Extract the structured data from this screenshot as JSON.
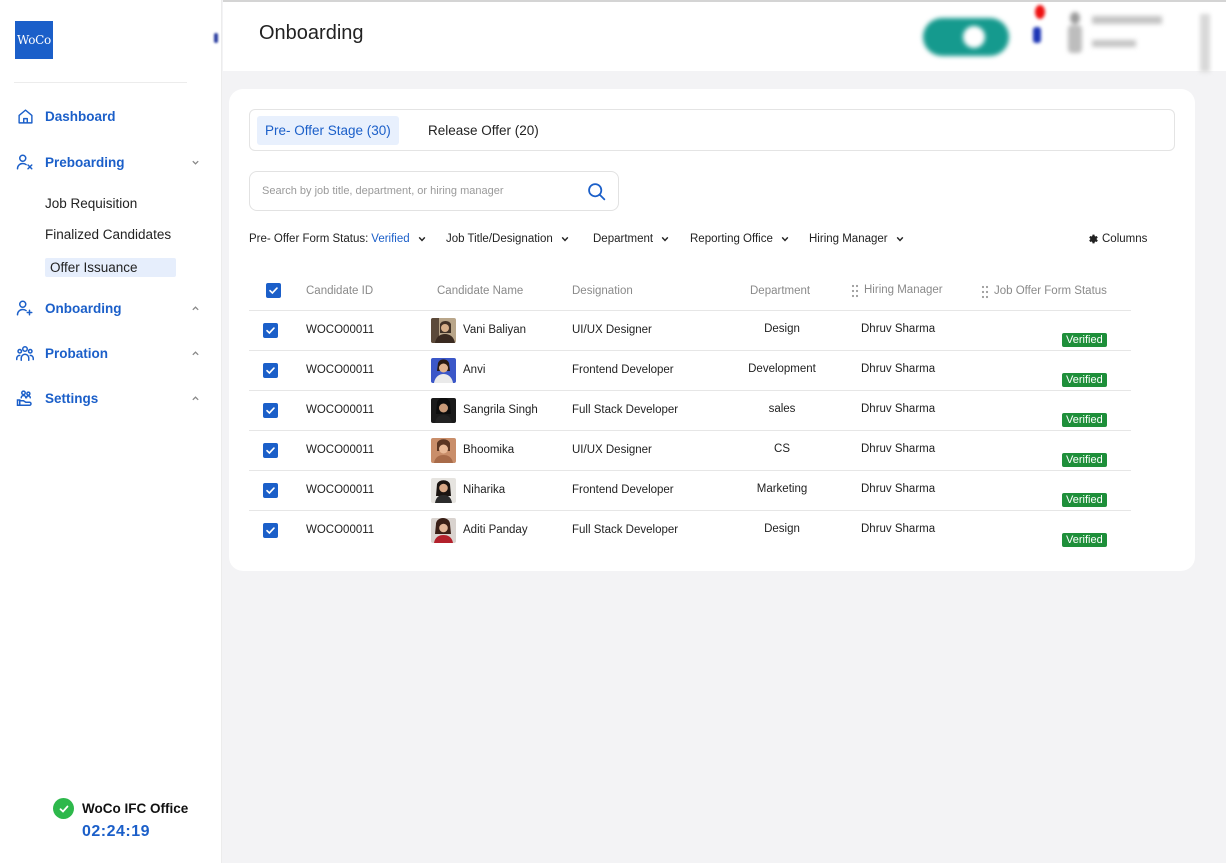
{
  "app": {
    "logo_text": "WoCo"
  },
  "header": {
    "title": "Onboarding"
  },
  "sidebar": {
    "items": [
      {
        "label": "Dashboard",
        "icon": "home-icon"
      },
      {
        "label": "Preboarding",
        "icon": "user-x-icon",
        "expanded": true,
        "children": [
          "Job Requisition",
          "Finalized Candidates",
          "Offer Issuance"
        ],
        "active_child": "Offer Issuance"
      },
      {
        "label": "Onboarding",
        "icon": "user-plus-icon"
      },
      {
        "label": "Probation",
        "icon": "users-icon"
      },
      {
        "label": "Settings",
        "icon": "hand-users-icon"
      }
    ],
    "office": {
      "name": "WoCo IFC Office",
      "timer": "02:24:19",
      "status_color": "#2db84b"
    }
  },
  "tabs": [
    {
      "label": "Pre- Offer Stage (30)",
      "active": true
    },
    {
      "label": "Release Offer (20)",
      "active": false
    }
  ],
  "search": {
    "placeholder": "Search by job title, department, or hiring manager",
    "value": ""
  },
  "filters": {
    "status_label": "Pre- Offer Form Status:",
    "status_value": "Verified",
    "job_title": "Job Title/Designation",
    "department": "Department",
    "reporting_office": "Reporting Office",
    "hiring_manager": "Hiring Manager",
    "columns": "Columns"
  },
  "table": {
    "headers": {
      "candidate_id": "Candidate ID",
      "candidate_name": "Candidate Name",
      "designation": "Designation",
      "department": "Department",
      "hiring_manager": "Hiring Manager",
      "status": "Job Offer Form Status"
    },
    "rows": [
      {
        "id": "WOCO00011",
        "name": "Vani Baliyan",
        "designation": "UI/UX Designer",
        "department": "Design",
        "manager": "Dhruv Sharma",
        "status": "Verified"
      },
      {
        "id": "WOCO00011",
        "name": "Anvi",
        "designation": "Frontend Developer",
        "department": "Development",
        "manager": "Dhruv Sharma",
        "status": "Verified"
      },
      {
        "id": "WOCO00011",
        "name": "Sangrila Singh",
        "designation": "Full Stack Developer",
        "department": "sales",
        "manager": "Dhruv Sharma",
        "status": "Verified"
      },
      {
        "id": "WOCO00011",
        "name": "Bhoomika",
        "designation": "UI/UX Designer",
        "department": "CS",
        "manager": "Dhruv Sharma",
        "status": "Verified"
      },
      {
        "id": "WOCO00011",
        "name": "Niharika",
        "designation": "Frontend Developer",
        "department": "Marketing",
        "manager": "Dhruv Sharma",
        "status": "Verified"
      },
      {
        "id": "WOCO00011",
        "name": "Aditi Panday",
        "designation": "Full Stack Developer",
        "department": "Design",
        "manager": "Dhruv Sharma",
        "status": "Verified"
      }
    ]
  },
  "colors": {
    "accent": "#1b5fc9",
    "verified": "#1e8f3a",
    "active_tab_bg": "#e8f0fd"
  }
}
